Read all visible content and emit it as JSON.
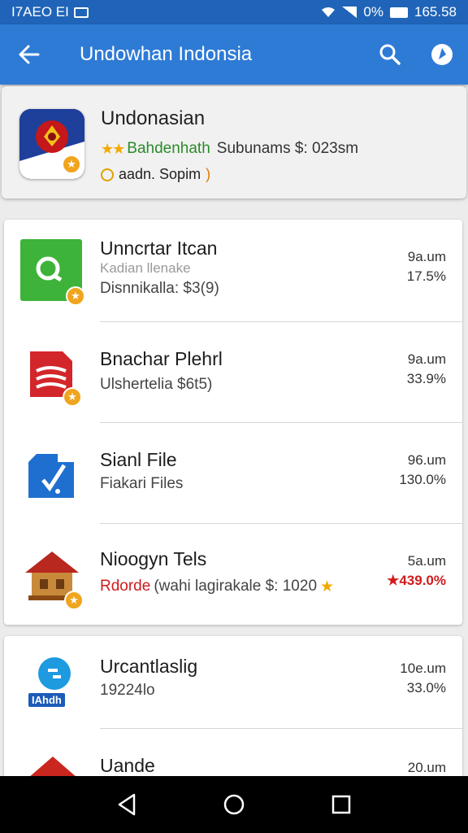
{
  "status_bar": {
    "left_text": "I7AEO EI",
    "battery_pct": "0%",
    "time": "165.58"
  },
  "app_bar": {
    "title": "Undowhan Indonsia",
    "back_icon": "arrow-left-icon",
    "search_icon": "search-icon",
    "action_icon": "compass-icon"
  },
  "featured": {
    "title": "Undonasian",
    "stars": "★★",
    "rating_text": "Bahdenhath",
    "subscriptions_text": "Subunams $: 023sm",
    "meta_text": "aadn. Sopim",
    "meta_arrow": ")"
  },
  "items": [
    {
      "title": "Unncrtar Itcan",
      "faded": "Kadian llenake",
      "sub": "Disnnikalla: $3(9)",
      "time": "9a.um",
      "pct": "17.5%",
      "icon": "green-q-icon"
    },
    {
      "title": "Bnachar Plehrl",
      "sub": "Ulshertelia $6t5)",
      "time": "9a.um",
      "pct": "33.9%",
      "icon": "red-document-icon"
    },
    {
      "title": "Sianl File",
      "sub": "Fiakari Files",
      "time": "96.um",
      "pct": "130.0%",
      "icon": "blue-folder-icon"
    },
    {
      "title": "Nioogyn Tels",
      "sub_red": "Rdorde",
      "sub": "(wahi lagirakale $: 1020",
      "sub_star": "★",
      "time": "5a.um",
      "pct_star": "★",
      "pct": "439.0%",
      "icon": "house-icon"
    },
    {
      "title": "Urcantlaslig",
      "sub": "19224lo",
      "time": "10e.um",
      "pct": "33.0%",
      "icon": "blue-circle-icon",
      "icon_label": "IAhdh"
    },
    {
      "title": "Uande",
      "time": "20.um",
      "icon": "red-roof-icon"
    }
  ],
  "nav": {
    "back": "nav-back-icon",
    "home": "nav-home-icon",
    "recents": "nav-recents-icon"
  },
  "colors": {
    "status_bar": "#1f64b8",
    "app_bar": "#2e7bd6",
    "accent_red": "#d01c1c",
    "star": "#f2a900"
  }
}
